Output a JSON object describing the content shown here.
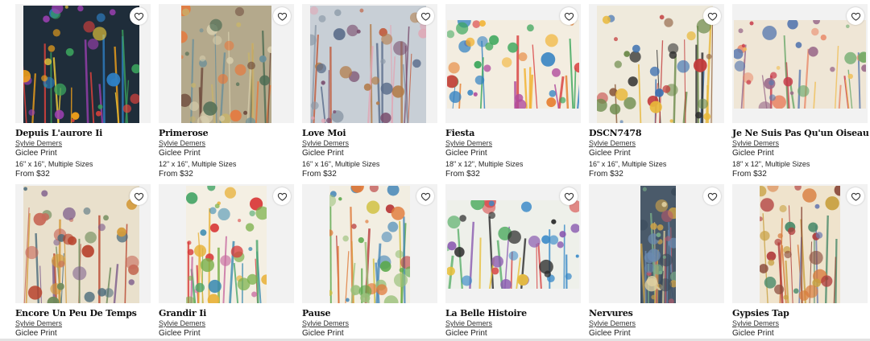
{
  "products": [
    {
      "title": "Depuis L'aurore Ii",
      "artist": "Sylvie Demers",
      "type": "Giclee Print",
      "size": "16\" x 16\", Multiple Sizes",
      "price": "From $32",
      "bg": "#1f2d3a",
      "p": [
        "#f4a31a",
        "#e8433c",
        "#3a9f5c",
        "#f7d23b",
        "#9a3fb0",
        "#2f7fc4"
      ]
    },
    {
      "title": "Primerose",
      "artist": "Sylvie Demers",
      "type": "Giclee Print",
      "size": "12\" x 16\", Multiple Sizes",
      "price": "From $32",
      "bg": "#b4a98c",
      "p": [
        "#e8773a",
        "#6a8f9a",
        "#c6b36e",
        "#6f4c3e",
        "#d8cfae",
        "#4b6b52"
      ]
    },
    {
      "title": "Love Moi",
      "artist": "Sylvie Demers",
      "type": "Giclee Print",
      "size": "16\" x 16\", Multiple Sizes",
      "price": "From $32",
      "bg": "#c8cfd6",
      "p": [
        "#7a4e6e",
        "#c15a3a",
        "#e1a7b5",
        "#5a6c8a",
        "#b37c4a",
        "#8c9aa8"
      ]
    },
    {
      "title": "Fiesta",
      "artist": "Sylvie Demers",
      "type": "Giclee Print",
      "size": "18\" x 12\", Multiple Sizes",
      "price": "From $32",
      "bg": "#f3ede0",
      "p": [
        "#d83b3b",
        "#3aa65a",
        "#f2b02a",
        "#2e7fc1",
        "#b04b9c",
        "#e67c2a"
      ]
    },
    {
      "title": "DSCN7478",
      "artist": "Sylvie Demers",
      "type": "Giclee Print",
      "size": "16\" x 16\", Multiple Sizes",
      "price": "From $32",
      "bg": "#efeadc",
      "p": [
        "#2c2c2c",
        "#6b8a4a",
        "#c23a3a",
        "#e8b83a",
        "#3a6fb0",
        "#8a5a3a"
      ]
    },
    {
      "title": "Je Ne Suis Pas Qu'un Oiseau",
      "artist": "Sylvie Demers",
      "type": "Giclee Print",
      "size": "18\" x 12\", Multiple Sizes",
      "price": "From $32",
      "bg": "#efe6d6",
      "p": [
        "#c83a4a",
        "#e98a6a",
        "#6aa86a",
        "#f0c05a",
        "#5a7ab0",
        "#9a6a8a"
      ]
    },
    {
      "title": "Encore Un Peu De Temps",
      "artist": "Sylvie Demers",
      "type": "Giclee Print",
      "bg": "#e9e0cc",
      "p": [
        "#b8442e",
        "#6e8a5a",
        "#d49a3a",
        "#7a5a8a",
        "#c86a5a",
        "#4a6a7a"
      ]
    },
    {
      "title": "Grandir Ii",
      "artist": "Sylvie Demers",
      "type": "Giclee Print",
      "bg": "#f4efe3",
      "p": [
        "#d83a3a",
        "#4aa66a",
        "#e8b23a",
        "#3a8ab0",
        "#c86aa0",
        "#7ab04a"
      ]
    },
    {
      "title": "Pause",
      "artist": "Sylvie Demers",
      "type": "Giclee Print",
      "bg": "#f2eee2",
      "p": [
        "#5aa84a",
        "#d0c040",
        "#e07a3a",
        "#4a8ab8",
        "#b83a3a",
        "#9ac07a"
      ]
    },
    {
      "title": "La Belle Histoire",
      "artist": "Sylvie Demers",
      "type": "Giclee Print",
      "bg": "#eef0ea",
      "p": [
        "#3a8ac8",
        "#d84a4a",
        "#5ab06a",
        "#e8c03a",
        "#8a5ab0",
        "#2a2a2a"
      ]
    },
    {
      "title": "Nervures",
      "artist": "Sylvie Demers",
      "type": "Giclee Print",
      "bg": "#4a5a6a",
      "p": [
        "#6a8ab0",
        "#c8a04a",
        "#3a4a5a",
        "#b85a6a",
        "#7ab08a",
        "#e0d0a0"
      ]
    },
    {
      "title": "Gypsies Tap",
      "artist": "Sylvie Demers",
      "type": "Giclee Print",
      "bg": "#efe3cc",
      "p": [
        "#8a4a3a",
        "#d87a3a",
        "#4a8a6a",
        "#c8a040",
        "#b03a3a",
        "#6a7ab0"
      ]
    }
  ]
}
